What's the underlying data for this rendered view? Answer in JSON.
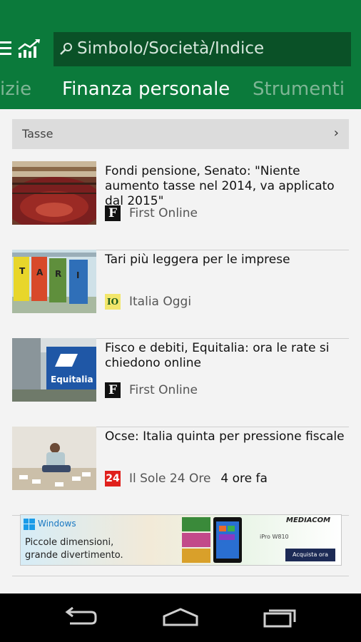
{
  "header": {
    "search_placeholder": "Simbolo/Società/Indice",
    "tabs": [
      {
        "label": "izie"
      },
      {
        "label": "Finanza personale"
      },
      {
        "label": "Strumenti"
      }
    ]
  },
  "section": {
    "title": "Tasse",
    "chevron": "›"
  },
  "articles": [
    {
      "headline": "Fondi pensione, Senato: \"Niente aumento tasse nel 2014, va applicato dal 2015\"",
      "logo": "F",
      "source": "First Online",
      "time": ""
    },
    {
      "headline": "Tari più leggera per le imprese",
      "logo": "IO",
      "source": "Italia Oggi",
      "time": ""
    },
    {
      "headline": "Fisco e debiti, Equitalia: ora le rate si chiedono online",
      "logo": "F",
      "source": "First Online",
      "time": ""
    },
    {
      "headline": "Ocse: Italia quinta per pressione fiscale",
      "logo": "24",
      "source": "Il Sole 24 Ore",
      "time": "4 ore fa"
    }
  ],
  "thumbnails": {
    "tari_bins": [
      "T",
      "A",
      "R",
      "I"
    ],
    "equitalia_sign": "Equitalia"
  },
  "ad": {
    "brand": "Windows",
    "tagline1": "Piccole dimensioni,",
    "tagline2": "grande divertimento.",
    "advertiser": "MEDIACOM",
    "product": "iPro W810",
    "cta": "Acquista ora"
  },
  "colors": {
    "header": "#0b7a3b",
    "search_bg": "#0a5127",
    "tab_inactive": "#7fb595",
    "background": "#f3f3f3"
  },
  "icons": [
    "menu-icon",
    "market-chart-icon",
    "search-icon",
    "chevron-right-icon",
    "back-icon",
    "home-icon",
    "recent-apps-icon"
  ]
}
